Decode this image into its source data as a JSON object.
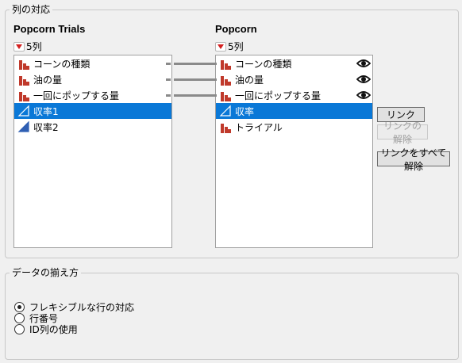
{
  "column_match_group": {
    "title": "列の対応",
    "left_table": {
      "title": "Popcorn Trials",
      "count": "5列",
      "items": [
        {
          "label": "コーンの種類",
          "icon": "nominal-bar-icon",
          "selected": false
        },
        {
          "label": "油の量",
          "icon": "nominal-bar-icon",
          "selected": false
        },
        {
          "label": "一回にポップする量",
          "icon": "nominal-bar-icon",
          "selected": false
        },
        {
          "label": "収率1",
          "icon": "continuous-triangle-icon",
          "selected": true
        },
        {
          "label": "収率2",
          "icon": "continuous-triangle-icon",
          "selected": false
        }
      ]
    },
    "right_table": {
      "title": "Popcorn",
      "count": "5列",
      "items": [
        {
          "label": "コーンの種類",
          "icon": "nominal-bar-icon",
          "selected": false,
          "eye": true
        },
        {
          "label": "油の量",
          "icon": "nominal-bar-icon",
          "selected": false,
          "eye": true
        },
        {
          "label": "一回にポップする量",
          "icon": "nominal-bar-icon",
          "selected": false,
          "eye": true
        },
        {
          "label": "収率",
          "icon": "continuous-triangle-icon",
          "selected": true,
          "eye": false
        },
        {
          "label": "トライアル",
          "icon": "nominal-bar-icon",
          "selected": false,
          "eye": false
        }
      ]
    },
    "buttons": {
      "link": "リンク",
      "unlink": "リンクの解除",
      "unlink_all": "リンクをすべて解除"
    }
  },
  "row_alignment_group": {
    "title": "データの揃え方",
    "options": [
      {
        "label": "フレキシブルな行の対応",
        "checked": true
      },
      {
        "label": "行番号",
        "checked": false
      },
      {
        "label": "ID列の使用",
        "checked": false
      }
    ]
  },
  "colors": {
    "selection": "#0a78d7",
    "nominal_icon": "#c0392b",
    "continuous_icon": "#2f5fb3"
  }
}
